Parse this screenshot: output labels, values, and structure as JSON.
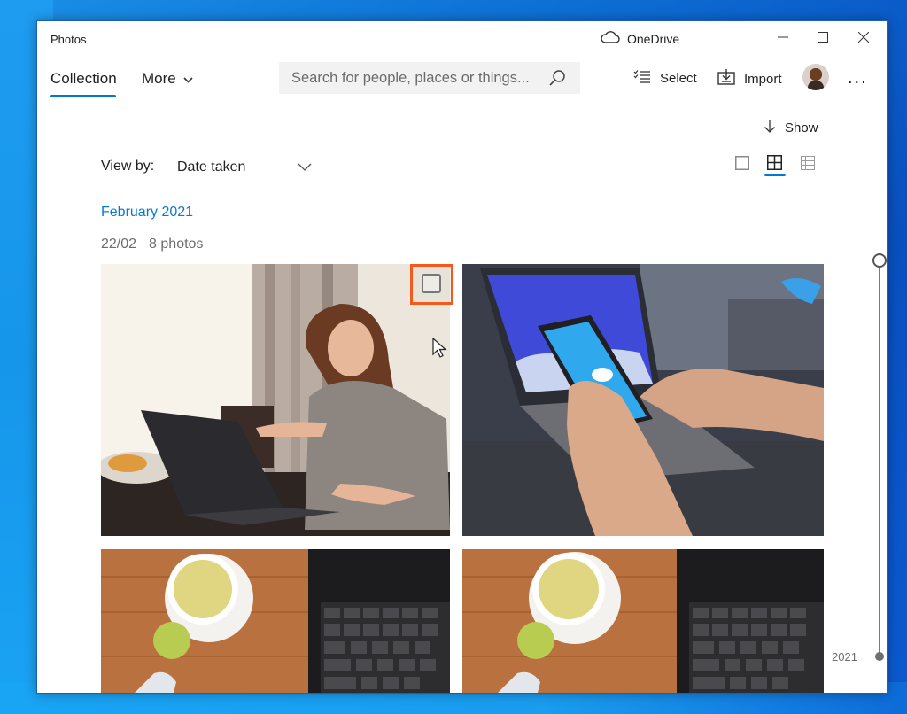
{
  "window": {
    "app_title": "Photos",
    "onedrive_label": "OneDrive",
    "controls": [
      "minimize",
      "maximize",
      "close"
    ]
  },
  "nav": {
    "tabs": [
      {
        "label": "Collection",
        "active": true
      },
      {
        "label": "More",
        "has_dropdown": true
      }
    ],
    "search": {
      "placeholder": "Search for people, places or things...",
      "value": ""
    },
    "toolbar": {
      "select_label": "Select",
      "import_label": "Import",
      "more_label": "..."
    }
  },
  "content": {
    "show_label": "Show",
    "view_by_label": "View by:",
    "view_by_value": "Date taken",
    "zoom_options": [
      {
        "name": "large",
        "active": false
      },
      {
        "name": "medium",
        "active": true
      },
      {
        "name": "small",
        "active": false
      }
    ],
    "month_heading": "February 2021",
    "day_group": {
      "date": "22/02",
      "count_label": "8 photos"
    },
    "photos": [
      {
        "subject": "woman-with-laptop",
        "hovered": true,
        "selection_checkbox_checked": false
      },
      {
        "subject": "phone-onedrive-laptop"
      },
      {
        "subject": "tea-cup-keyboard"
      },
      {
        "subject": "tea-cup-keyboard"
      }
    ],
    "timeline": {
      "year_label": "2021"
    }
  },
  "colors": {
    "accent": "#0078d4",
    "month_link": "#0a79d6",
    "highlight": "#f25a1d",
    "desktop": "#0d6fd4"
  }
}
